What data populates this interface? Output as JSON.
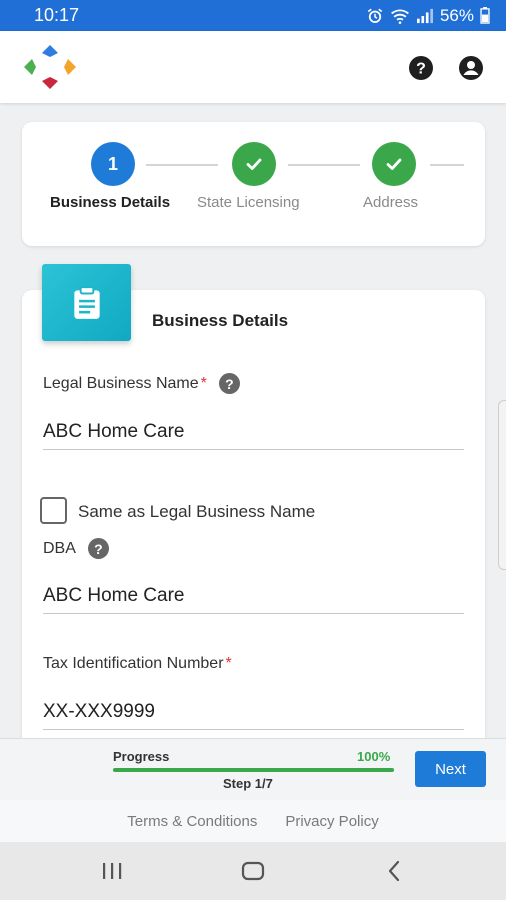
{
  "status_bar": {
    "time": "10:17",
    "battery": "56%",
    "icons": [
      "alarm-icon",
      "wifi-icon",
      "signal-icon",
      "battery-icon"
    ]
  },
  "header": {
    "logo": "app-logo",
    "icons": [
      "help-icon",
      "account-icon"
    ]
  },
  "stepper": {
    "steps": [
      {
        "label": "Business Details",
        "marker": "1",
        "state": "active"
      },
      {
        "label": "State Licensing",
        "marker": "check",
        "state": "complete"
      },
      {
        "label": "Address",
        "marker": "check",
        "state": "complete"
      }
    ]
  },
  "form": {
    "title": "Business Details",
    "legal_name": {
      "label": "Legal Business Name",
      "required_mark": "*",
      "value": "ABC Home Care"
    },
    "same_as_legal": {
      "label": "Same as Legal Business Name",
      "checked": false
    },
    "dba": {
      "label": "DBA",
      "value": "ABC Home Care"
    },
    "tax_id": {
      "label": "Tax Identification Number",
      "required_mark": "*",
      "value": "XX-XXX9999"
    }
  },
  "progress": {
    "label": "Progress",
    "percent_text": "100%",
    "value": 1.0,
    "step_text": "Step 1/7",
    "next_label": "Next"
  },
  "footer": {
    "terms": "Terms & Conditions",
    "privacy": "Privacy Policy"
  },
  "nav": [
    "recents-icon",
    "home-icon",
    "back-icon"
  ],
  "colors": {
    "primary": "#1f7bd8",
    "success": "#3aa84a",
    "status_bar": "#1f6fd6",
    "accent_tile": "#1cb6cc",
    "required": "#d33333"
  }
}
